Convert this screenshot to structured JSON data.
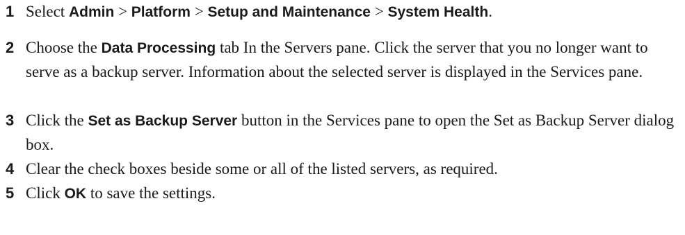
{
  "steps": [
    {
      "number": "1",
      "parts": [
        "Select ",
        "Admin",
        " > ",
        "Platform",
        " > ",
        "Setup and Maintenance",
        " > ",
        "System Health",
        "."
      ]
    },
    {
      "number": "2",
      "parts": [
        "Choose the ",
        "Data Processing",
        " tab In the Servers pane. Click the server that you no longer want to serve as a backup server. Information about the selected server is displayed in the Services pane."
      ]
    },
    {
      "number": "3",
      "parts": [
        "Click the ",
        "Set as Backup Server",
        " button in the Services pane to open the Set as Backup Server dialog box."
      ]
    },
    {
      "number": "4",
      "parts": [
        "Clear the check boxes beside some or all of the listed servers, as required."
      ]
    },
    {
      "number": "5",
      "parts": [
        "Click ",
        "OK",
        " to save the settings."
      ]
    }
  ]
}
